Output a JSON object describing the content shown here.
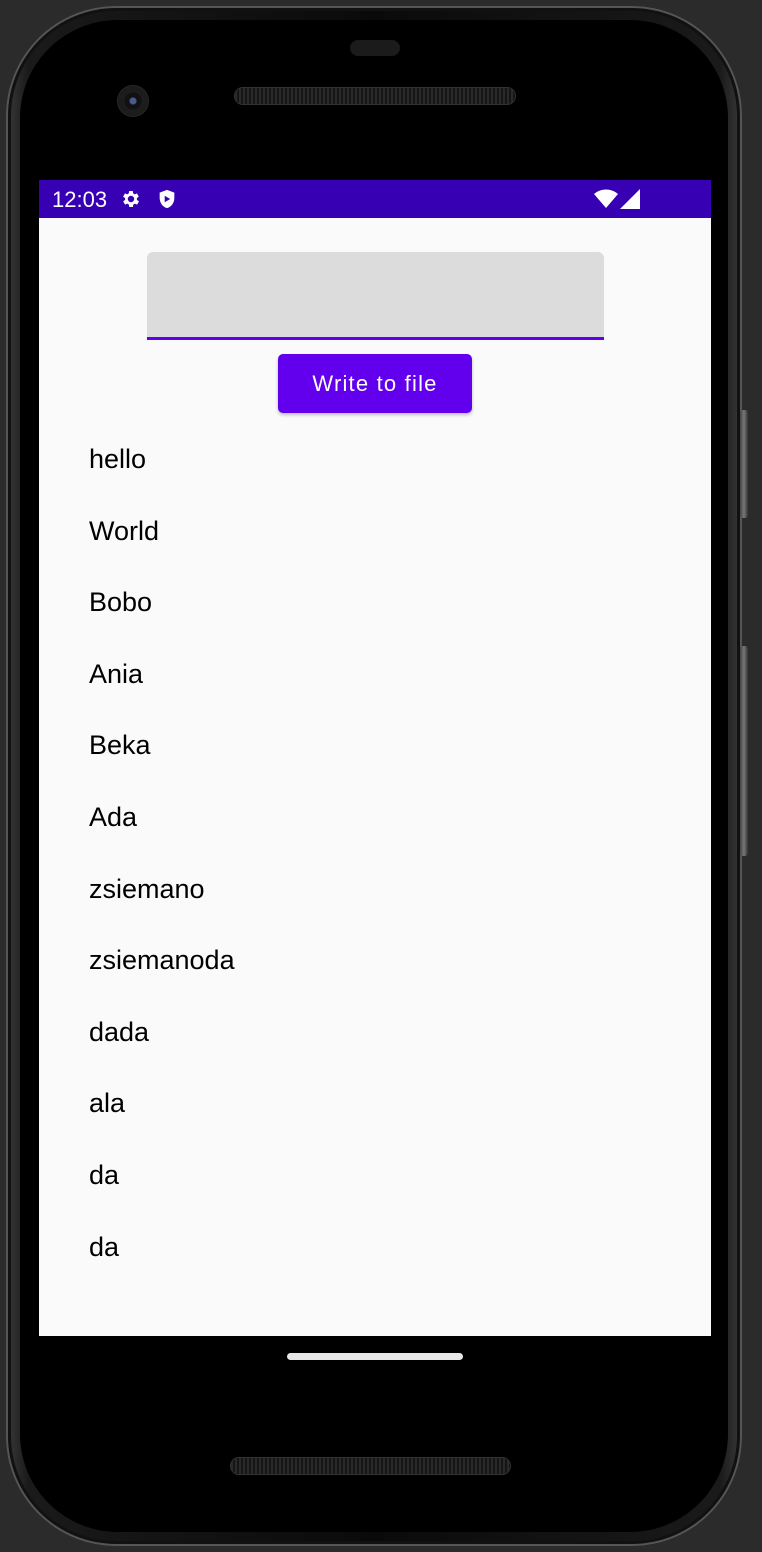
{
  "status_bar": {
    "time": "12:03",
    "icons": [
      "settings-icon",
      "shield-icon",
      "wifi-icon",
      "cell-signal-icon"
    ],
    "background": "#3700b3"
  },
  "input": {
    "value": "",
    "placeholder": "",
    "underline_color": "#6200ee"
  },
  "button": {
    "label": "Write to file",
    "color": "#6200ee"
  },
  "list": {
    "items": [
      "hello",
      "World",
      "Bobo",
      "Ania",
      "Beka",
      "Ada",
      "zsiemano",
      "zsiemanoda",
      "dada",
      "ala",
      "da",
      "da"
    ]
  }
}
